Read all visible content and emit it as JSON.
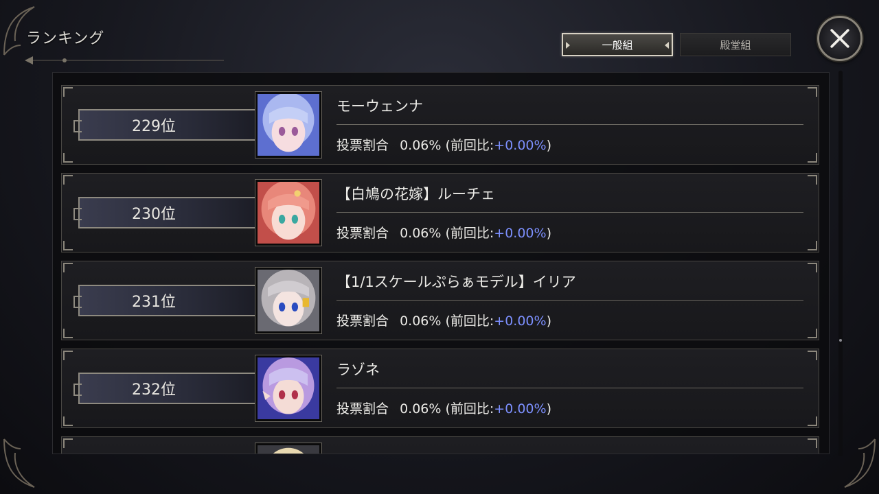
{
  "header": {
    "title": "ランキング"
  },
  "tabs": [
    {
      "label": "一般組",
      "active": true
    },
    {
      "label": "殿堂組",
      "active": false
    }
  ],
  "close_icon": "close-x-icon",
  "list": {
    "vote_label": "投票割合",
    "prev_open": "(前回比:",
    "prev_close": ")",
    "rows": [
      {
        "rank": "229位",
        "name": "モーウェンナ",
        "share": "0.06%",
        "diff": "+0.00%",
        "hair": "#aab8f0",
        "skin": "#f6dde0"
      },
      {
        "rank": "230位",
        "name": "【白鳩の花嫁】ルーチェ",
        "share": "0.06%",
        "diff": "+0.00%",
        "hair": "#e8877a",
        "skin": "#f8dcd4"
      },
      {
        "rank": "231位",
        "name": "【1/1スケールぷらぁモデル】イリア",
        "share": "0.06%",
        "diff": "+0.00%",
        "hair": "#b8b4b8",
        "skin": "#f4e4e0"
      },
      {
        "rank": "232位",
        "name": "ラゾネ",
        "share": "0.06%",
        "diff": "+0.00%",
        "hair": "#b99ae0",
        "skin": "#f4dcd6"
      },
      {
        "rank": "",
        "name": "",
        "share": "",
        "diff": "",
        "hair": "#e8d8b0",
        "skin": "#f4e0d0"
      }
    ]
  },
  "colors": {
    "accent_diff": "#7d90ff",
    "frame": "#8e8a80",
    "plate": "#2a2c3a"
  }
}
